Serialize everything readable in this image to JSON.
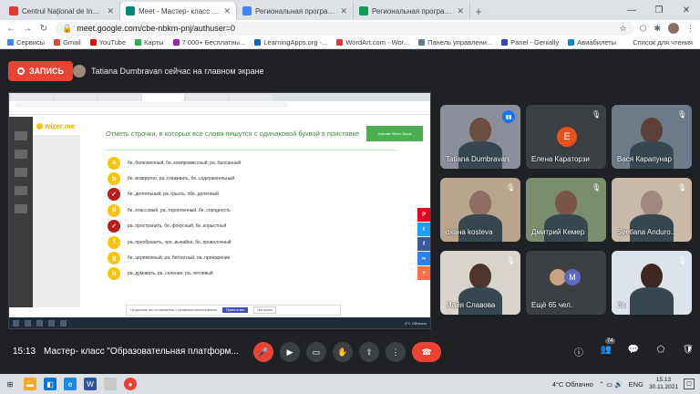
{
  "browser": {
    "tabs": [
      {
        "title": "Centrul Național de Inovații Digi",
        "color": "#e53935",
        "active": false
      },
      {
        "title": "Meet - Мастер- класс \"Обр",
        "color": "#00897b",
        "active": true
      },
      {
        "title": "Региональная программа мен",
        "color": "#4285f4",
        "active": false
      },
      {
        "title": "Региональная программа мен",
        "color": "#0f9d58",
        "active": false
      }
    ],
    "url": "meet.google.com/cbe-nbkm-pnj/authuser=0",
    "bookmarks": [
      {
        "label": "Сервисы",
        "color": "#4285f4"
      },
      {
        "label": "Gmail",
        "color": "#ea4335"
      },
      {
        "label": "YouTube",
        "color": "#ff0000"
      },
      {
        "label": "Карты",
        "color": "#34a853"
      },
      {
        "label": "7 000+ Бесплатны...",
        "color": "#9c27b0"
      },
      {
        "label": "LearningApps.org -...",
        "color": "#1565c0"
      },
      {
        "label": "WordArt.com - Wor...",
        "color": "#e53935"
      },
      {
        "label": "Панель управлени...",
        "color": "#607d8b"
      },
      {
        "label": "Panel - Genially",
        "color": "#3949ab"
      },
      {
        "label": "Авиабилеты",
        "color": "#0288d1"
      }
    ],
    "bookmarks_right": "Список для чтения"
  },
  "meet": {
    "record_label": "ЗАПИСЬ",
    "presenter_text": "Tatiana Dumbravan сейчас на главном экране",
    "time": "15:13",
    "meeting_title": "Мастер- класс \"Образовательная платформ...",
    "participant_count": "74",
    "participants": [
      {
        "name": "Tatiana Dumbravan",
        "kind": "video",
        "speaking": true
      },
      {
        "name": "Елена Караторзи",
        "kind": "letter",
        "letter": "Е"
      },
      {
        "name": "Вася Карапунар",
        "kind": "video"
      },
      {
        "name": "оxана kostеva",
        "kind": "video"
      },
      {
        "name": "Дмитрий Кемер",
        "kind": "video"
      },
      {
        "name": "Svetlana Anduro...",
        "kind": "video"
      },
      {
        "name": "Майя Славова",
        "kind": "video"
      },
      {
        "name": "Ещё 65 чел.",
        "kind": "more",
        "letter": "M"
      },
      {
        "name": "Вы",
        "kind": "video"
      }
    ]
  },
  "shared_screen": {
    "site_logo": "wizer.me",
    "header_button": "Activate Wizer Boost",
    "task_title": "Отметь строчки, в которых все слова пишутся с одинаковой буквой в приставке",
    "options": [
      {
        "letter": "a",
        "text": "бе..болезненный, бе..компромиссный, ра..бросанный",
        "checked": false
      },
      {
        "letter": "b",
        "text": "бе..возвратно, ра..глаживать, бе..содержательный",
        "checked": false
      },
      {
        "letter": "✓",
        "text": "бе..деятельный, ра..грызть, обе..доленный",
        "checked": true
      },
      {
        "letter": "d",
        "text": "бе..классовый, ра..торопленный, бе..спрядность",
        "checked": false
      },
      {
        "letter": "✓",
        "text": "ра..пространить, бе..фокусный, бе..корыстный",
        "checked": true
      },
      {
        "letter": "f",
        "text": "ра..преобразить, чре..вычайно, бе..проволочный",
        "checked": false
      },
      {
        "letter": "g",
        "text": "бе..церемонный, ра..бегнатный, на..прожарение",
        "checked": false
      },
      {
        "letter": "h",
        "text": "ра..думавать, ра..селение, ра..четливый",
        "checked": false
      }
    ],
    "consent_text": "Продолжая, вы соглашаетесь с условиями использования",
    "consent_accept": "Принять все",
    "consent_settings": "Настроить"
  },
  "taskbar": {
    "weather": "4°C Облачно",
    "lang": "ENG",
    "time": "15:13",
    "date": "30.11.2021"
  }
}
